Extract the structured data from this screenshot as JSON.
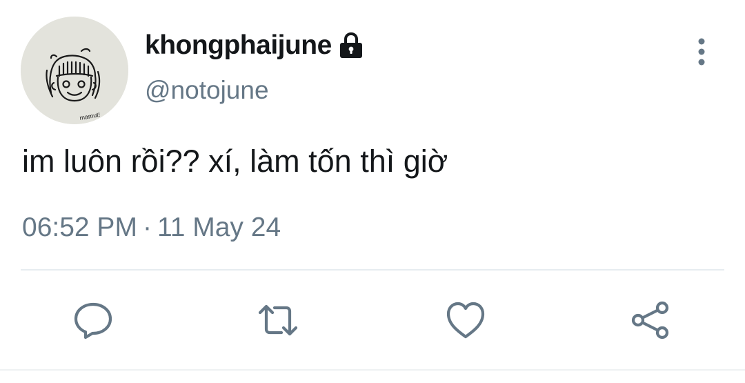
{
  "author": {
    "display_name": "khongphaijune",
    "handle": "@notojune",
    "protected": true,
    "avatar_doodle_text": "mamut!"
  },
  "tweet": {
    "text": "im luôn rồi?? xí, làm tốn thì giờ",
    "time": "06:52 PM",
    "separator": "·",
    "date": "11 May 24"
  },
  "icons": {
    "lock": "lock-icon",
    "more": "more-vertical-icon",
    "reply": "reply-icon",
    "retweet": "retweet-icon",
    "like": "heart-icon",
    "share": "share-icon"
  },
  "colors": {
    "text_primary": "#14171a",
    "text_secondary": "#657786",
    "icon_gray": "#657786",
    "divider": "#e6ecf0"
  }
}
